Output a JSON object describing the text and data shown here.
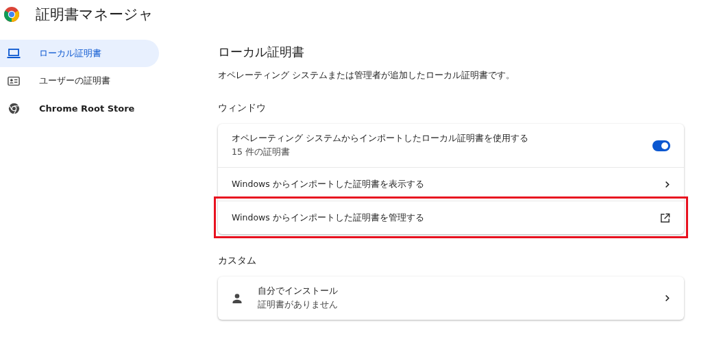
{
  "app": {
    "title": "証明書マネージャ"
  },
  "sidebar": {
    "items": [
      {
        "label": "ローカル証明書",
        "selected": true
      },
      {
        "label": "ユーザーの証明書",
        "selected": false
      },
      {
        "label": "Chrome Root Store",
        "selected": false
      }
    ]
  },
  "page": {
    "title": "ローカル証明書",
    "description": "オペレーティング システムまたは管理者が追加したローカル証明書です。",
    "sections": [
      {
        "heading": "ウィンドウ",
        "rows": [
          {
            "kind": "toggle",
            "label": "オペレーティング システムからインポートしたローカル証明書を使用する",
            "sublabel": "15 件の証明書",
            "on": true,
            "highlighted": false
          },
          {
            "kind": "link",
            "label": "Windows からインポートした証明書を表示する",
            "highlighted": false
          },
          {
            "kind": "external",
            "label": "Windows からインポートした証明書を管理する",
            "highlighted": true
          }
        ]
      },
      {
        "heading": "カスタム",
        "rows": [
          {
            "kind": "account",
            "label": "自分でインストール",
            "sublabel": "証明書がありません",
            "highlighted": false
          }
        ]
      }
    ]
  }
}
